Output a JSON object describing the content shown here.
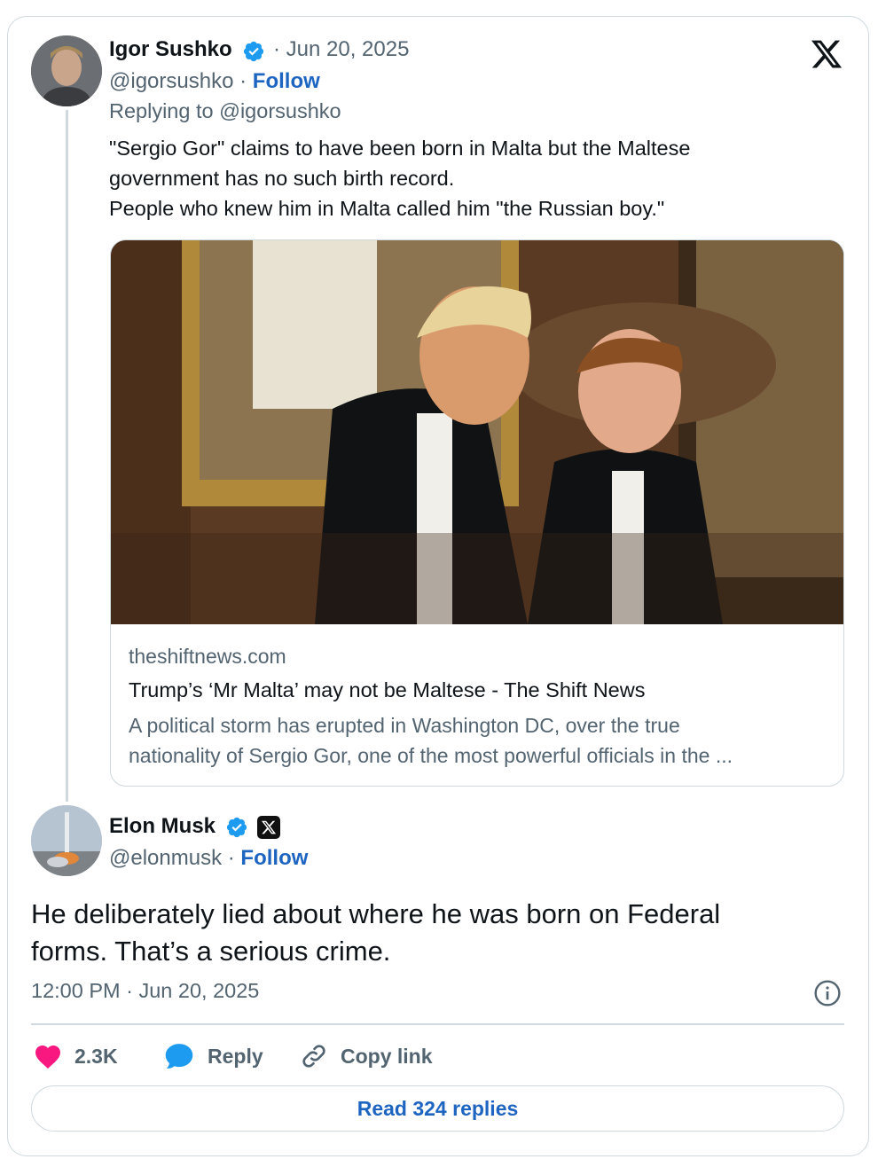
{
  "reply_tweet": {
    "author_name": "Igor Sushko",
    "date": "· Jun 20, 2025",
    "handle": "@igorsushko",
    "follow_label": "Follow",
    "handle_sep": "·",
    "replying_to": "Replying to @igorsushko",
    "text_lines": [
      "\"Sergio Gor\" claims to have been born in Malta but the Maltese",
      "government has no such birth record.",
      "People who knew him in Malta called him \"the Russian boy.\""
    ],
    "link_card": {
      "domain": "theshiftnews.com",
      "title": "Trump’s ‘Mr Malta’ may not be Maltese - The Shift News",
      "description_lines": [
        "A political storm has erupted in Washington DC, over the true",
        "nationality of Sergio Gor, one of the most powerful officials in the ..."
      ]
    }
  },
  "main_tweet": {
    "author_name": "Elon Musk",
    "handle": "@elonmusk",
    "handle_sep": "·",
    "follow_label": "Follow",
    "text_lines": [
      "He deliberately lied about where he was born on Federal",
      "forms. That’s a serious crime."
    ],
    "timestamp": "12:00 PM · Jun 20, 2025"
  },
  "actions": {
    "like_count": "2.3K",
    "reply_label": "Reply",
    "copy_link_label": "Copy link",
    "read_replies_label": "Read 324 replies"
  },
  "colors": {
    "accent": "#1d65c1",
    "verified": "#1d9bf0",
    "like": "#f91880",
    "muted": "#536471",
    "border": "#cfd9de"
  },
  "icons": [
    "x-logo-icon",
    "verified-badge-icon",
    "heart-icon",
    "reply-bubble-icon",
    "link-icon",
    "info-icon",
    "x-affiliate-badge-icon"
  ]
}
